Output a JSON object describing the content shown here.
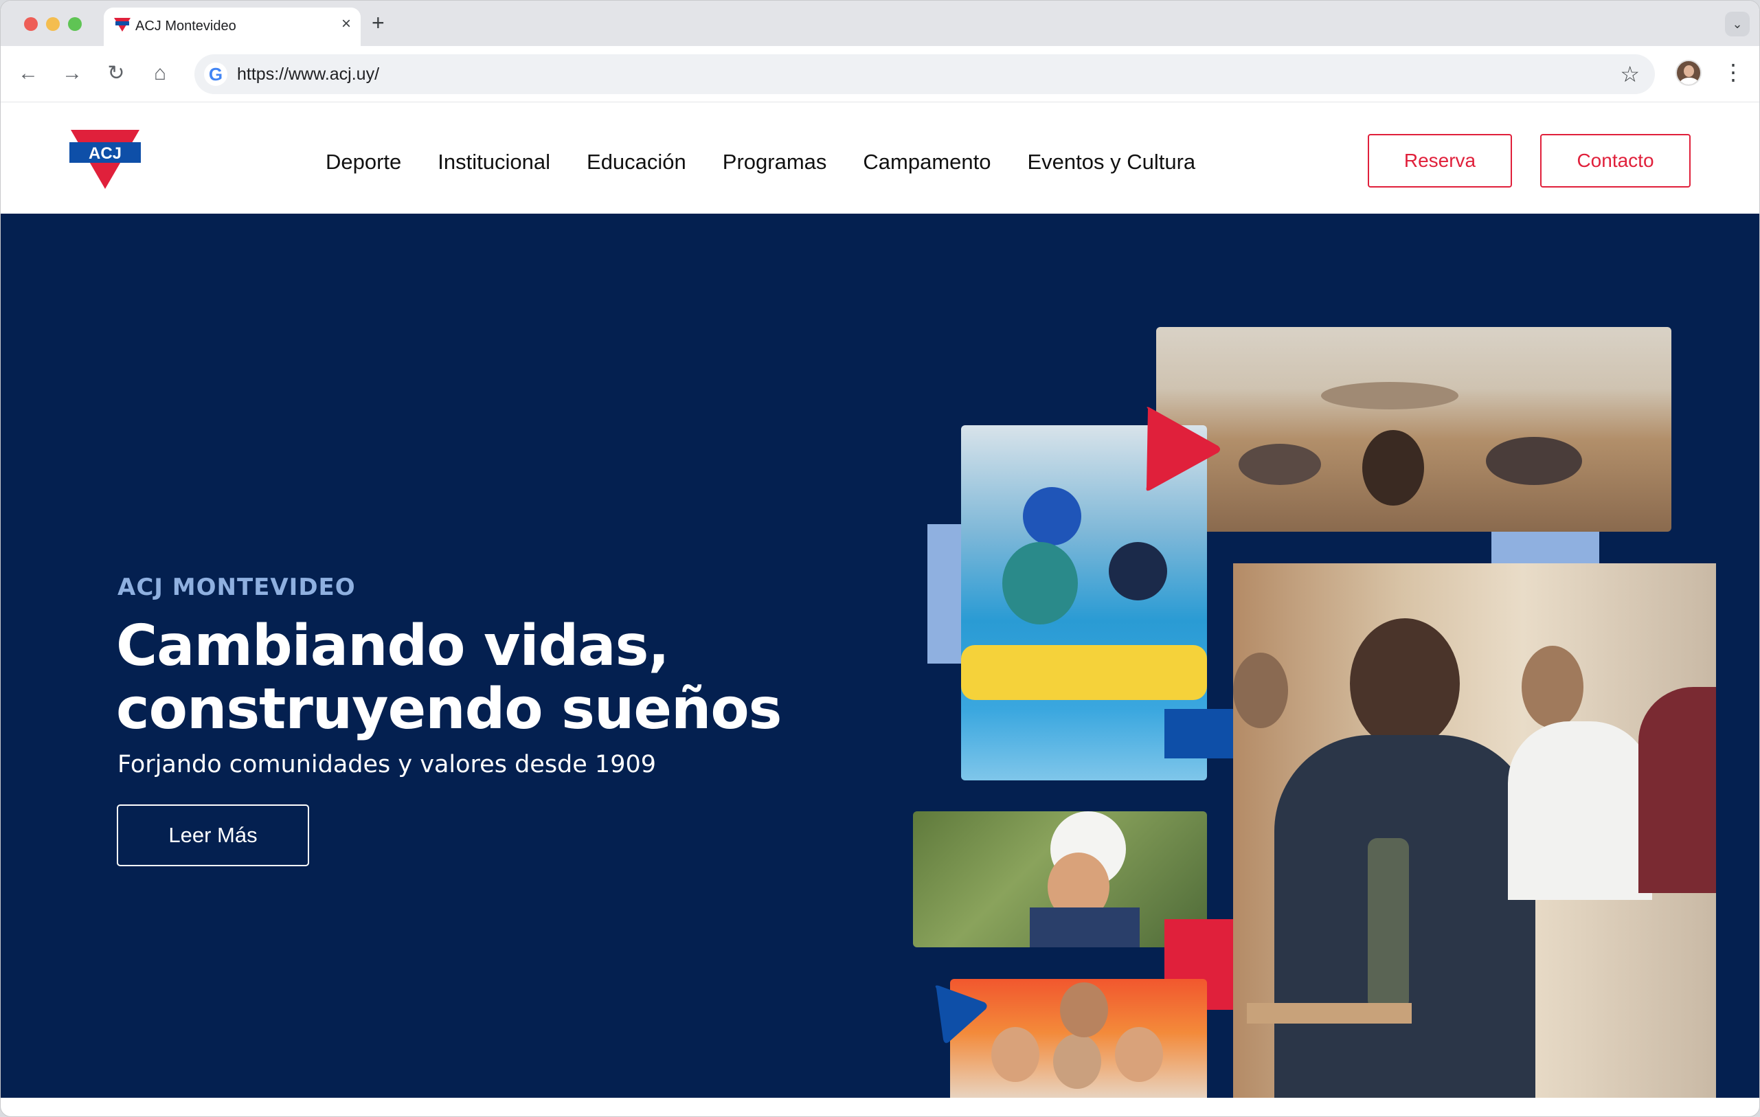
{
  "browser": {
    "tab_title": "ACJ Montevideo",
    "tab_close": "×",
    "new_tab": "+",
    "tab_menu": "⌄",
    "url": "https://www.acj.uy/",
    "back": "←",
    "forward": "→",
    "reload": "↻",
    "home": "⌂",
    "bookmark": "☆",
    "menu": "⋮",
    "google": "G"
  },
  "site": {
    "logo_text": "ACJ",
    "nav": [
      "Deporte",
      "Institucional",
      "Educación",
      "Programas",
      "Campamento",
      "Eventos y Cultura"
    ],
    "buttons": {
      "reserva": "Reserva",
      "contacto": "Contacto"
    }
  },
  "hero": {
    "eyebrow": "ACJ MONTEVIDEO",
    "headline_line1": "Cambiando vidas,",
    "headline_line2": "construyendo sueños",
    "subline": "Forjando comunidades y valores desde 1909",
    "cta": "Leer Más"
  },
  "colors": {
    "brand_red": "#e0203b",
    "brand_navy": "#042050",
    "brand_blue": "#0e4fa8",
    "accent_light_blue": "#8fb0e0"
  }
}
